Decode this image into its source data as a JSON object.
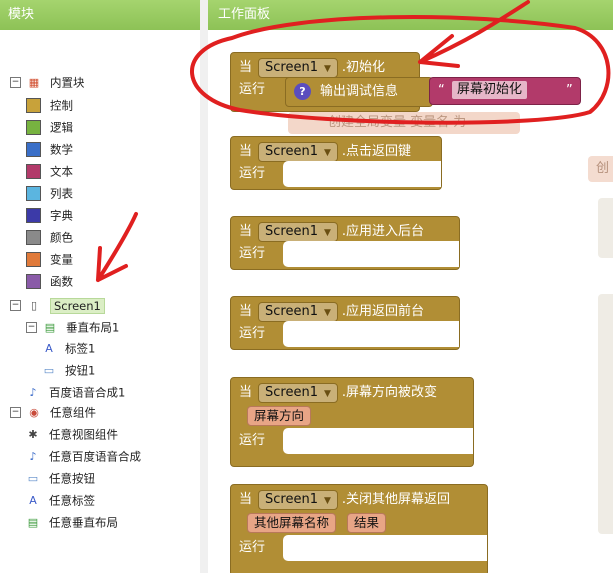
{
  "left_panel": {
    "title": "模块",
    "tree": [
      {
        "key": "builtin",
        "label": "内置块",
        "toggle": "−",
        "level": 0
      },
      {
        "key": "control",
        "label": "控制",
        "color": "#c8a23a",
        "level": 1
      },
      {
        "key": "logic",
        "label": "逻辑",
        "color": "#77b340",
        "level": 1
      },
      {
        "key": "math",
        "label": "数学",
        "color": "#3a6fc8",
        "level": 1
      },
      {
        "key": "text",
        "label": "文本",
        "color": "#b23a6a",
        "level": 1
      },
      {
        "key": "list",
        "label": "列表",
        "color": "#5bb5e0",
        "level": 1
      },
      {
        "key": "dict",
        "label": "字典",
        "color": "#3c3aa8",
        "level": 1
      },
      {
        "key": "color",
        "label": "颜色",
        "color": "#8a8a8a",
        "level": 1
      },
      {
        "key": "var",
        "label": "变量",
        "color": "#e07a3a",
        "level": 1
      },
      {
        "key": "proc",
        "label": "函数",
        "color": "#8a5ba8",
        "level": 1
      },
      {
        "key": "screen1",
        "label": "Screen1",
        "toggle": "−",
        "level": 0
      },
      {
        "key": "vlayout",
        "label": "垂直布局1",
        "toggle": "−",
        "level": 1
      },
      {
        "key": "label1",
        "label": "标签1",
        "level": 2
      },
      {
        "key": "button1",
        "label": "按钮1",
        "level": 2
      },
      {
        "key": "tts1",
        "label": "百度语音合成1",
        "level": 1
      },
      {
        "key": "any",
        "label": "任意组件",
        "toggle": "−",
        "level": 0
      },
      {
        "key": "any_view",
        "label": "任意视图组件",
        "level": 1
      },
      {
        "key": "any_tts",
        "label": "任意百度语音合成",
        "level": 1
      },
      {
        "key": "any_button",
        "label": "任意按钮",
        "level": 1
      },
      {
        "key": "any_label",
        "label": "任意标签",
        "level": 1
      },
      {
        "key": "any_vlayout",
        "label": "任意垂直布局",
        "level": 1
      }
    ]
  },
  "workspace": {
    "title": "工作面板",
    "ghost_text": "创建全局变量 变量名 为",
    "ghost_right": "创",
    "events": [
      {
        "when": "当",
        "component": "Screen1",
        "event": ".初始化",
        "run": "运行",
        "params": [],
        "debug": {
          "label": "输出调试信息",
          "help": "?"
        },
        "string": {
          "open": "“",
          "value": "屏幕初始化",
          "close": "”"
        }
      },
      {
        "when": "当",
        "component": "Screen1",
        "event": ".点击返回键",
        "run": "运行",
        "params": []
      },
      {
        "when": "当",
        "component": "Screen1",
        "event": ".应用进入后台",
        "run": "运行",
        "params": []
      },
      {
        "when": "当",
        "component": "Screen1",
        "event": ".应用返回前台",
        "run": "运行",
        "params": []
      },
      {
        "when": "当",
        "component": "Screen1",
        "event": ".屏幕方向被改变",
        "run": "运行",
        "params": [
          "屏幕方向"
        ]
      },
      {
        "when": "当",
        "component": "Screen1",
        "event": ".关闭其他屏幕返回",
        "run": "运行",
        "params": [
          "其他屏幕名称",
          "结果"
        ]
      }
    ]
  },
  "colors": {
    "header": "#8dc256",
    "event_block": "#b18e35",
    "text_block": "#b23a6a",
    "param": "#e8a586",
    "annotation": "#e02020"
  }
}
